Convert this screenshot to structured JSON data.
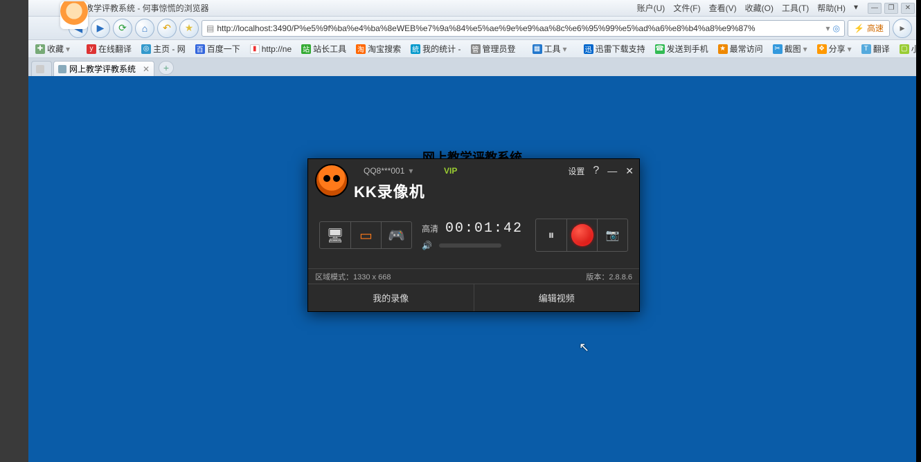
{
  "browser": {
    "window_title": "网上教学评教系统 - 何事惊慌的浏览器",
    "menus": {
      "account": "账户(U)",
      "file": "文件(F)",
      "view": "查看(V)",
      "fav": "收藏(O)",
      "tools": "工具(T)",
      "help": "帮助(H)"
    },
    "url": "http://localhost:3490/P%e5%9f%ba%e4%ba%8eWEB%e7%9a%84%e5%ae%9e%e9%aa%8c%e6%95%99%e5%ad%a6%e8%b4%a8%e9%87%",
    "speed_label": "高速",
    "bookmarks": {
      "addfav": "收藏",
      "trans": "在线翻译",
      "home": "主页 - 网",
      "baidu": "百度一下",
      "httpne": "http://ne",
      "site": "站长工具",
      "taobao": "淘宝搜索",
      "stats": "我的统计 -",
      "admin": "管理员登",
      "toolbox": "工具",
      "thunder": "迅雷下载支持",
      "sendphone": "发送到手机",
      "freq": "最常访问",
      "screenshot": "截图",
      "share": "分享",
      "translate": "翻译",
      "mini": "小号窗口"
    },
    "tab_label": "网上教学评教系统",
    "page_heading": "网上教学评教系统"
  },
  "kk": {
    "brand": "KK录像机",
    "user": "QQ8***001",
    "vip": "VIP",
    "settings": "设置",
    "quality_label": "高清",
    "timer": "00:01:42",
    "region_mode": "区域模式：1330 x 668",
    "version": "版本：2.8.8.6",
    "my_recordings": "我的录像",
    "edit_video": "编辑视频"
  },
  "icons": {
    "collapse": "▾",
    "help": "?",
    "min": "—",
    "close": "✕",
    "monitor": "🖥",
    "region": "▭",
    "game": "🎮",
    "pause": "⏸",
    "camera": "📷",
    "speaker": "🔊",
    "back": "◀",
    "fwd": "▶",
    "reload": "⟳",
    "homeico": "⌂",
    "undo": "↶",
    "star": "★",
    "globe": "🌐",
    "more": "▸",
    "plus": "+"
  }
}
